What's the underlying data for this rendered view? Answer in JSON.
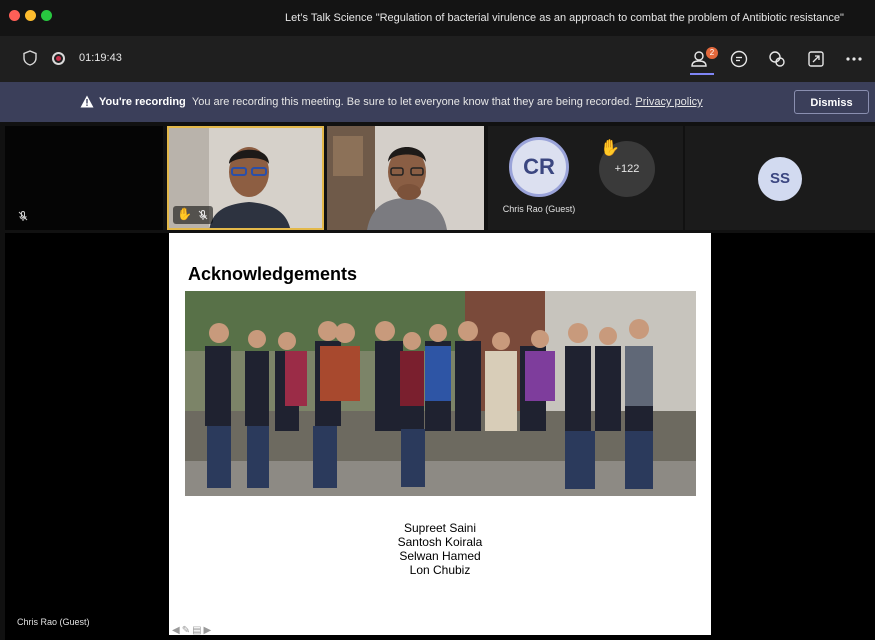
{
  "window": {
    "title": "Let’s Talk Science \"Regulation of bacterial virulence as an approach to combat the problem of Antibiotic resistance\""
  },
  "toolbar": {
    "timer": "01:19:43",
    "participants_badge": "2",
    "icons": [
      "shield-icon",
      "record-icon",
      "people-icon",
      "chat-icon",
      "reactions-icon",
      "share-icon",
      "more-icon"
    ]
  },
  "banner": {
    "title": "You're recording",
    "message": "You are recording this meeting. Be sure to let everyone know that they are being recorded.",
    "link": "Privacy policy",
    "dismiss": "Dismiss",
    "color": "#3b3f5a"
  },
  "participants": {
    "cr_initials": "CR",
    "cr_name": "Chris Rao (Guest)",
    "overflow_count": "+122",
    "ss_initials": "SS",
    "speaker_border_color": "#e4b94a"
  },
  "slide": {
    "title": "Acknowledgements",
    "names": [
      "Supreet Saini",
      "Santosh Koirala",
      "Selwan Hamed",
      "Lon Chubiz"
    ]
  },
  "presenter": {
    "name": "Chris Rao (Guest)"
  }
}
